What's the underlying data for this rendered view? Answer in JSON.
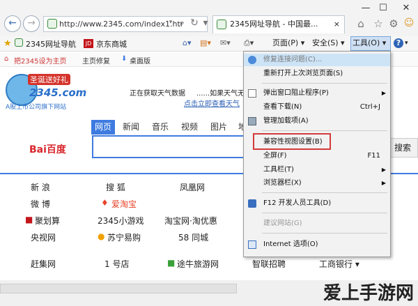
{
  "window": {
    "min": "—",
    "max": "☐",
    "close": "✕"
  },
  "nav": {
    "back": "←",
    "forward": "→"
  },
  "address": {
    "url": "http://www.2345.com/index1.htr"
  },
  "tab": {
    "title": "2345网址导航 - 中国最...",
    "close": "×"
  },
  "favbar": {
    "items": [
      "2345网址导航",
      "JD",
      "京东商城"
    ]
  },
  "commandbar": {
    "page": "页面(P) ▾",
    "safety": "安全(S) ▾",
    "tools": "工具(O) ▾",
    "help": "?"
  },
  "pagebar": {
    "sethome": "把2345设为主页",
    "fix": "主页修复",
    "desktop": "桌面版"
  },
  "logo": {
    "banner": "圣诞送好礼",
    "brand": "2345.com",
    "slogan": "A股上市公司旗下网站"
  },
  "weather": {
    "left": "正在获取天气数据",
    "right": "......如果天气无法",
    "link": "点击立即查看天气"
  },
  "search": {
    "tabs": [
      "网页",
      "新闻",
      "音乐",
      "视频",
      "图片",
      "地图"
    ],
    "brand": "Bai百度",
    "button": "搜索"
  },
  "links": {
    "rows": [
      [
        "新 浪",
        "搜 狐",
        "凤凰网",
        "",
        ""
      ],
      [
        "微 博",
        "爱淘宝",
        "",
        "",
        ""
      ],
      [
        "聚划算",
        "2345小游戏",
        "淘宝网·淘优惠",
        "",
        ""
      ],
      [
        "央视网",
        "苏宁易购",
        "58 同城",
        "",
        ""
      ],
      [
        "赶集网",
        "1 号店",
        "途牛旅游网",
        "智联招聘",
        "工商银行 ▾"
      ]
    ]
  },
  "menu": {
    "items": [
      {
        "label": "修复连接问题(C)...",
        "shortcut": "",
        "arrow": ""
      },
      {
        "label": "重新打开上次浏览页面(S)",
        "shortcut": "",
        "arrow": ""
      },
      {
        "label": "弹出窗口阻止程序(P)",
        "shortcut": "",
        "arrow": "▶"
      },
      {
        "label": "查看下载(N)",
        "shortcut": "Ctrl+J",
        "arrow": ""
      },
      {
        "label": "管理加载项(A)",
        "shortcut": "",
        "arrow": ""
      },
      {
        "label": "兼容性视图设置(B)",
        "shortcut": "",
        "arrow": ""
      },
      {
        "label": "全屏(F)",
        "shortcut": "F11",
        "arrow": ""
      },
      {
        "label": "工具栏(T)",
        "shortcut": "",
        "arrow": "▶"
      },
      {
        "label": "浏览器栏(X)",
        "shortcut": "",
        "arrow": "▶"
      },
      {
        "label": "F12 开发人员工具(D)",
        "shortcut": "",
        "arrow": ""
      },
      {
        "label": "建议网站(G)",
        "shortcut": "",
        "arrow": ""
      },
      {
        "label": "Internet 选项(O)",
        "shortcut": "",
        "arrow": ""
      }
    ]
  },
  "watermark": {
    "text": "爱上手游网"
  },
  "colors": {
    "accent": "#3e7be0",
    "highlight": "#d23a3a",
    "menu_bg": "#f2f2f2"
  }
}
